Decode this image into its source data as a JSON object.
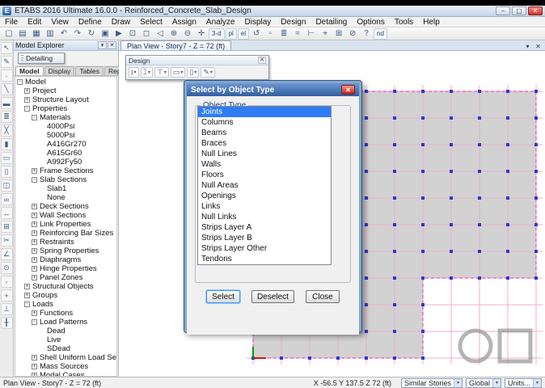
{
  "window": {
    "title": "ETABS 2016 Ultimate 16.0.0 - Reinforced_Concrete_Slab_Design",
    "controls": {
      "minimize": "–",
      "maximize": "▢",
      "close": "✕"
    }
  },
  "menu": {
    "items": [
      "File",
      "Edit",
      "View",
      "Define",
      "Draw",
      "Select",
      "Assign",
      "Analyze",
      "Display",
      "Design",
      "Detailing",
      "Options",
      "Tools",
      "Help"
    ]
  },
  "toolbar": {
    "icons": [
      {
        "name": "new-model",
        "glyph": "▢"
      },
      {
        "name": "open-model",
        "glyph": "▤"
      },
      {
        "name": "save-model",
        "glyph": "▦"
      },
      {
        "name": "print",
        "glyph": "▥"
      },
      {
        "name": "undo",
        "glyph": "↶"
      },
      {
        "name": "redo",
        "glyph": "↷"
      },
      {
        "name": "refresh-window",
        "glyph": "↻"
      },
      {
        "name": "lock-model",
        "glyph": "▣"
      },
      {
        "name": "run-analysis",
        "glyph": "▶"
      },
      {
        "name": "rubber-band-zoom",
        "glyph": "⊡"
      },
      {
        "name": "restore-full-view",
        "glyph": "◻"
      },
      {
        "name": "previous-zoom",
        "glyph": "◁"
      },
      {
        "name": "zoom-in",
        "glyph": "⊕"
      },
      {
        "name": "zoom-out",
        "glyph": "⊖"
      },
      {
        "name": "pan",
        "glyph": "✛"
      },
      {
        "name": "view-3d",
        "glyph": "3-d"
      },
      {
        "name": "view-plan",
        "glyph": "pl"
      },
      {
        "name": "view-elevation",
        "glyph": "el"
      },
      {
        "name": "rotate-3d-view",
        "glyph": "↺"
      },
      {
        "name": "object-shrink-toggle",
        "glyph": "▫"
      },
      {
        "name": "set-display-options",
        "glyph": "≣"
      },
      {
        "name": "show-deformed-shape",
        "glyph": "≈"
      },
      {
        "name": "assign-menu",
        "glyph": "⊢"
      },
      {
        "name": "select-menu",
        "glyph": "⌖"
      },
      {
        "name": "snap-options",
        "glyph": "⊞"
      },
      {
        "name": "clear-selection",
        "glyph": "⊘"
      },
      {
        "name": "help",
        "glyph": "?"
      },
      {
        "name": "detailing-nd",
        "glyph": "nd"
      }
    ]
  },
  "draw_toolbar": {
    "icons": [
      {
        "name": "select-pointer",
        "glyph": "↖"
      },
      {
        "name": "reshape-object",
        "glyph": "✎"
      },
      {
        "name": "draw-joint",
        "glyph": "∙"
      },
      {
        "name": "draw-frame",
        "glyph": "╲"
      },
      {
        "name": "quick-draw-beam",
        "glyph": "▬"
      },
      {
        "name": "quick-draw-secondary-beams",
        "glyph": "≣"
      },
      {
        "name": "quick-draw-brace",
        "glyph": "╳"
      },
      {
        "name": "draw-floor",
        "glyph": "▮"
      },
      {
        "name": "quick-draw-floor",
        "glyph": "▭"
      },
      {
        "name": "draw-wall",
        "glyph": "▯"
      },
      {
        "name": "quick-draw-wall",
        "glyph": "◫"
      },
      {
        "name": "draw-link",
        "glyph": "∞"
      },
      {
        "name": "draw-dimension-line",
        "glyph": "↔"
      },
      {
        "name": "draw-grid-line",
        "glyph": "⊞"
      },
      {
        "name": "draw-section-cut",
        "glyph": "✂"
      },
      {
        "name": "measure-tool",
        "glyph": "∠"
      },
      {
        "name": "snap-to-joints",
        "glyph": "⊙"
      },
      {
        "name": "snap-to-midpoints",
        "glyph": "◦"
      },
      {
        "name": "snap-to-intersections",
        "glyph": "+"
      },
      {
        "name": "snap-to-perpendicular",
        "glyph": "⊥"
      },
      {
        "name": "snap-to-lines",
        "glyph": "╂"
      }
    ]
  },
  "model_explorer": {
    "title": "Model Explorer",
    "menu_glyph": "▾",
    "close_glyph": "✕",
    "tabs": [
      "Model",
      "Display",
      "Tables",
      "Reports"
    ],
    "active_tab": "Model",
    "tree": [
      {
        "label": "Model",
        "level": 0,
        "expand": "minus"
      },
      {
        "label": "Project",
        "level": 1,
        "expand": "plus"
      },
      {
        "label": "Structure Layout",
        "level": 1,
        "expand": "plus"
      },
      {
        "label": "Properties",
        "level": 1,
        "expand": "minus"
      },
      {
        "label": "Materials",
        "level": 2,
        "expand": "minus"
      },
      {
        "label": "4000Psi",
        "level": 3,
        "expand": "none"
      },
      {
        "label": "5000Psi",
        "level": 3,
        "expand": "none"
      },
      {
        "label": "A416Gr270",
        "level": 3,
        "expand": "none"
      },
      {
        "label": "A615Gr60",
        "level": 3,
        "expand": "none"
      },
      {
        "label": "A992Fy50",
        "level": 3,
        "expand": "none"
      },
      {
        "label": "Frame Sections",
        "level": 2,
        "expand": "plus"
      },
      {
        "label": "Slab Sections",
        "level": 2,
        "expand": "minus"
      },
      {
        "label": "Slab1",
        "level": 3,
        "expand": "none"
      },
      {
        "label": "None",
        "level": 3,
        "expand": "none"
      },
      {
        "label": "Deck Sections",
        "level": 2,
        "expand": "plus"
      },
      {
        "label": "Wall Sections",
        "level": 2,
        "expand": "plus"
      },
      {
        "label": "Link Properties",
        "level": 2,
        "expand": "plus"
      },
      {
        "label": "Reinforcing Bar Sizes",
        "level": 2,
        "expand": "plus"
      },
      {
        "label": "Restraints",
        "level": 2,
        "expand": "plus"
      },
      {
        "label": "Spring Properties",
        "level": 2,
        "expand": "plus"
      },
      {
        "label": "Diaphragms",
        "level": 2,
        "expand": "plus"
      },
      {
        "label": "Hinge Properties",
        "level": 2,
        "expand": "plus"
      },
      {
        "label": "Panel Zones",
        "level": 2,
        "expand": "plus"
      },
      {
        "label": "Structural Objects",
        "level": 1,
        "expand": "plus"
      },
      {
        "label": "Groups",
        "level": 1,
        "expand": "plus"
      },
      {
        "label": "Loads",
        "level": 1,
        "expand": "minus"
      },
      {
        "label": "Functions",
        "level": 2,
        "expand": "plus"
      },
      {
        "label": "Load Patterns",
        "level": 2,
        "expand": "minus"
      },
      {
        "label": "Dead",
        "level": 3,
        "expand": "none"
      },
      {
        "label": "Live",
        "level": 3,
        "expand": "none"
      },
      {
        "label": "SDead",
        "level": 3,
        "expand": "none"
      },
      {
        "label": "Shell Uniform Load Se",
        "level": 2,
        "expand": "plus"
      },
      {
        "label": "Mass Sources",
        "level": 2,
        "expand": "plus"
      },
      {
        "label": "Modal Cases",
        "level": 2,
        "expand": "plus"
      }
    ]
  },
  "detailing_toolbar": {
    "title": "Detailing"
  },
  "design_toolbar": {
    "title": "Design",
    "close_glyph": "✕",
    "icons": [
      {
        "name": "steel-frame-design",
        "glyph": "I"
      },
      {
        "name": "concrete-frame-design",
        "glyph": "⌶"
      },
      {
        "name": "composite-beam-design",
        "glyph": "⊤"
      },
      {
        "name": "slab-design",
        "glyph": "▭"
      },
      {
        "name": "shear-wall-design",
        "glyph": "▯"
      },
      {
        "name": "design-settings",
        "glyph": "✎"
      }
    ]
  },
  "plan_view": {
    "tab_label": "Plan View - Story7 - Z = 72 (ft)",
    "menu_glyph": "▾",
    "close_glyph": "✕"
  },
  "dialog": {
    "title": "Select by Object Type",
    "close_glyph": "✕",
    "group_label": "Object Type",
    "items": [
      "Joints",
      "Columns",
      "Beams",
      "Braces",
      "Null Lines",
      "Walls",
      "Floors",
      "Null Areas",
      "Openings",
      "Links",
      "Null Links",
      "Strips Layer A",
      "Strips Layer B",
      "Strips Layer Other",
      "Tendons"
    ],
    "selected": "Joints",
    "buttons": {
      "select": "Select",
      "deselect": "Deselect",
      "close": "Close"
    }
  },
  "status_bar": {
    "left": "Plan View - Story7 - Z = 72 (ft)",
    "coordinates": "X -56.5   Y 137.5   Z 72 (ft)",
    "dropdowns": [
      "Similar Stories",
      "Global",
      "Units..."
    ]
  },
  "glyphs": {
    "chevron_down": "▾"
  },
  "colors": {
    "selection_blue": "#2e7df6",
    "dialog_title_blue": "#315e9f",
    "grid_pink": "#efaccf",
    "slab_boundary_magenta": "#ff2bb4",
    "slab_gray": "#d2d2d2",
    "joint_dot_blue": "#2b3cc8",
    "axis_red": "#e01010",
    "axis_green": "#0a9a0a"
  }
}
